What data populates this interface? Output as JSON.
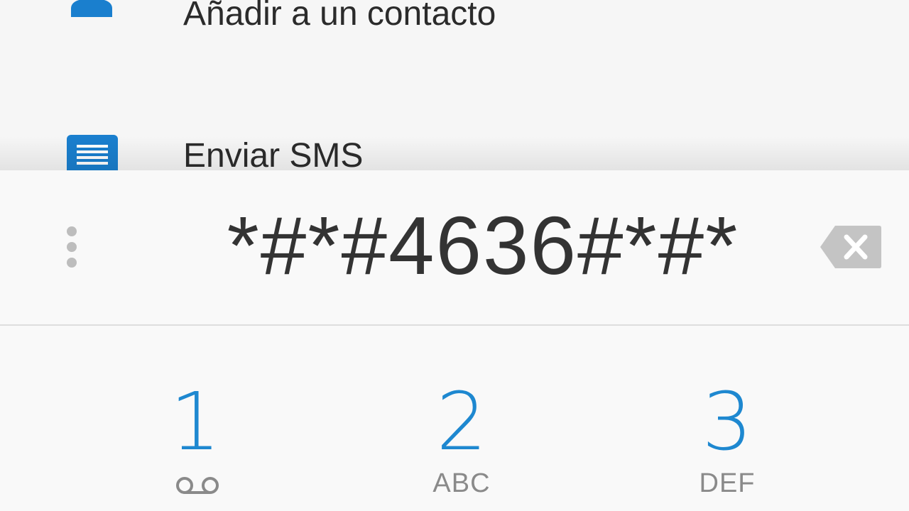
{
  "menu": {
    "add_contact_label": "Añadir a un contacto",
    "send_sms_label": "Enviar SMS"
  },
  "dialer": {
    "number": "*#*#4636#*#*",
    "keys": [
      {
        "digit": "1",
        "letters": "",
        "icon": "voicemail-icon"
      },
      {
        "digit": "2",
        "letters": "ABC"
      },
      {
        "digit": "3",
        "letters": "DEF"
      }
    ]
  },
  "colors": {
    "accent": "#1e88d0",
    "icon_blue": "#1a7fce",
    "text_dark": "#333333",
    "text_muted": "#8a8a8a",
    "icon_gray": "#bdbdbd"
  },
  "icons": {
    "contact": "person-add-icon",
    "sms": "message-icon",
    "overflow": "more-vert-icon",
    "delete": "backspace-icon"
  }
}
